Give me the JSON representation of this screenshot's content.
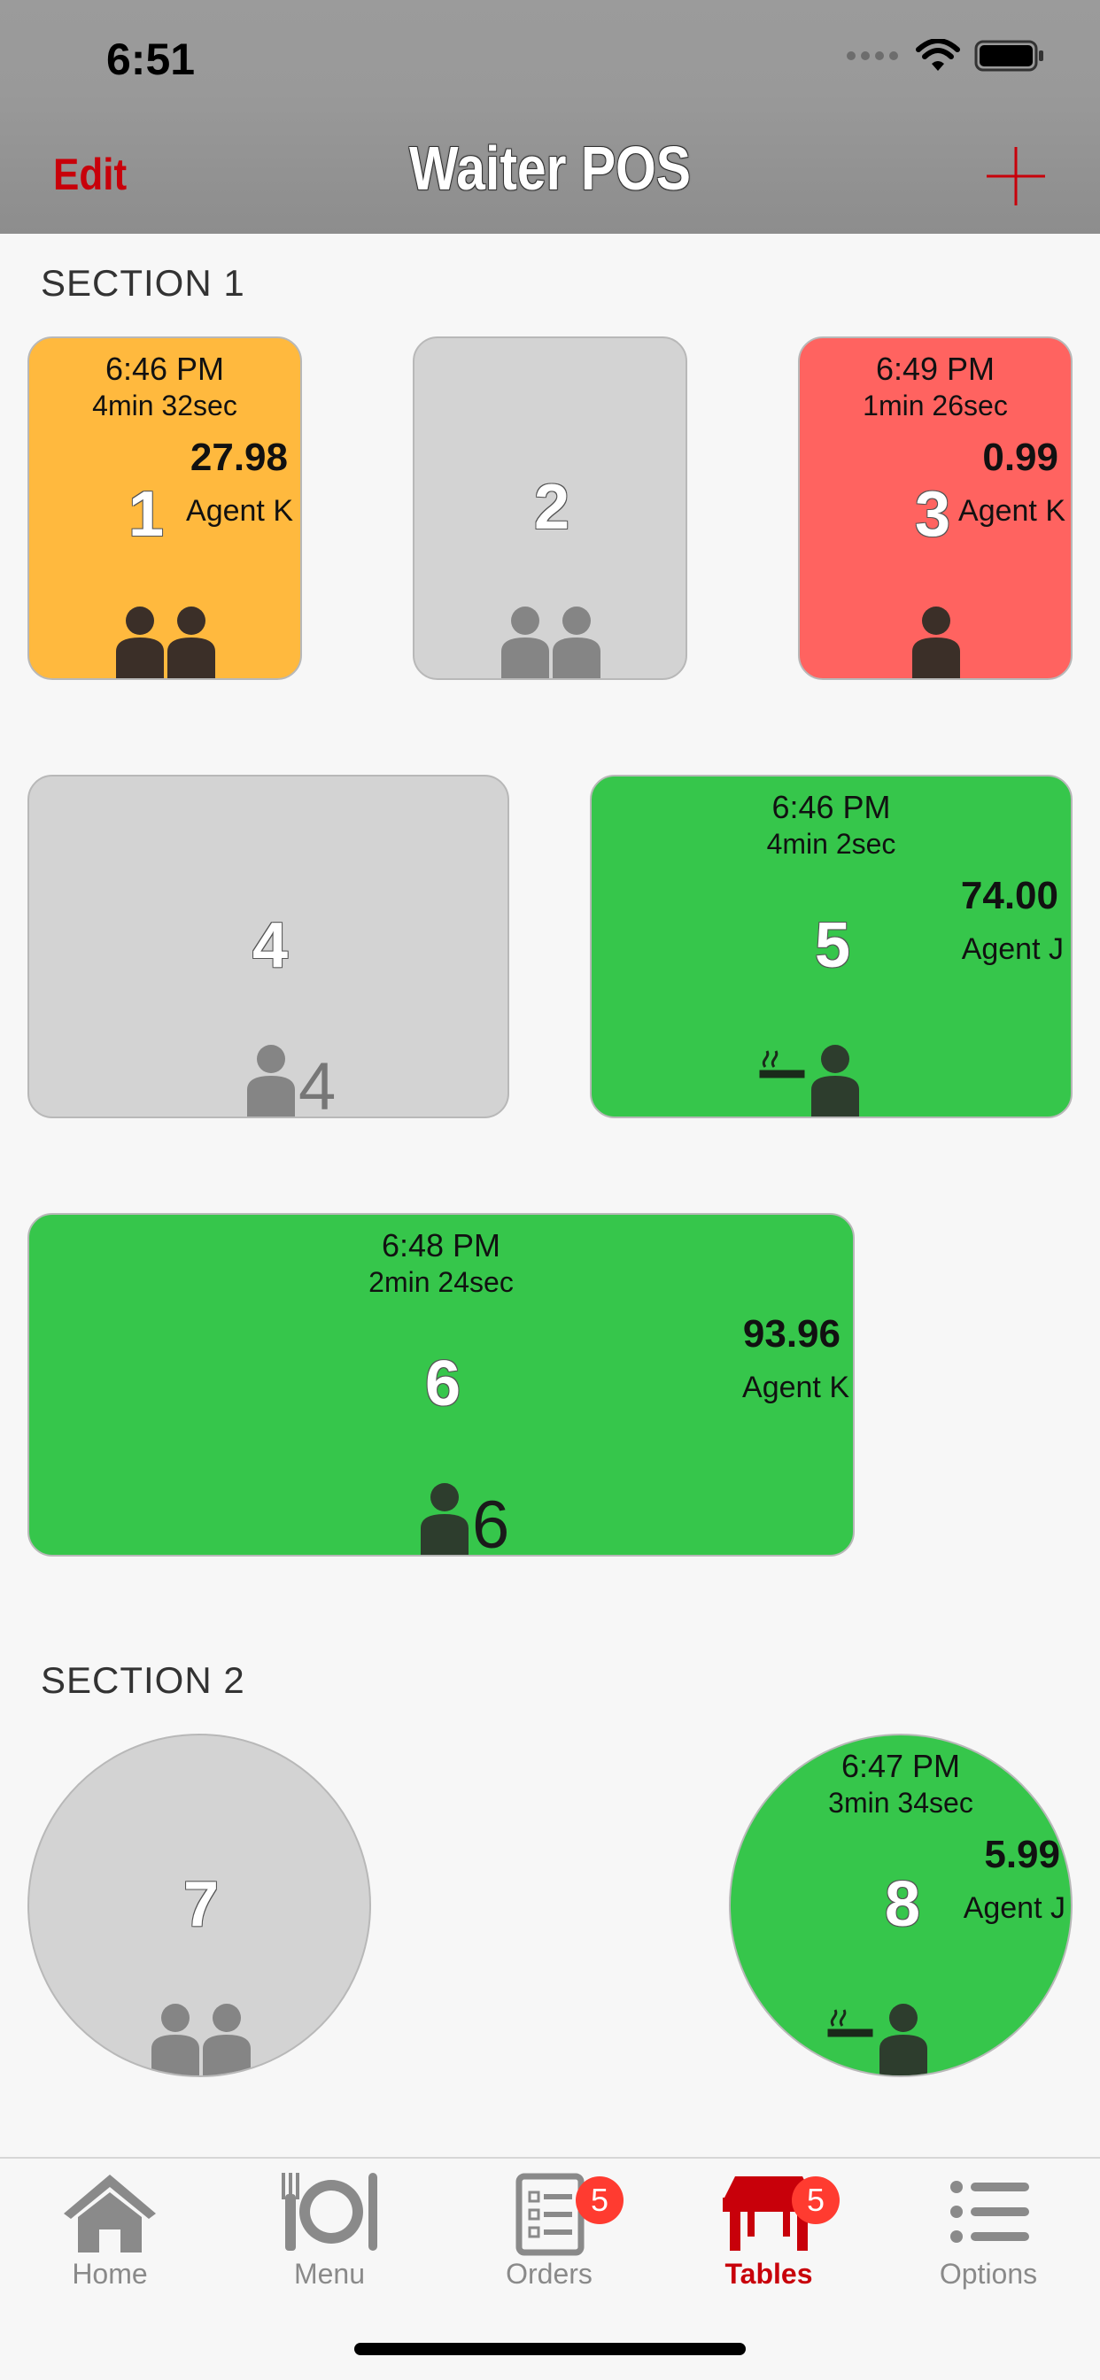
{
  "status_bar": {
    "time": "6:51"
  },
  "nav": {
    "edit_label": "Edit",
    "title": "Waiter POS"
  },
  "sections": [
    {
      "title": "SECTION 1"
    },
    {
      "title": "SECTION 2"
    }
  ],
  "tables": {
    "t1": {
      "number": "1",
      "time": "6:46 PM",
      "elapsed": "4min 32sec",
      "amount": "27.98",
      "agent": "Agent K"
    },
    "t2": {
      "number": "2"
    },
    "t3": {
      "number": "3",
      "time": "6:49 PM",
      "elapsed": "1min 26sec",
      "amount": "0.99",
      "agent": "Agent K"
    },
    "t4": {
      "number": "4",
      "guest_count": "4"
    },
    "t5": {
      "number": "5",
      "time": "6:46 PM",
      "elapsed": "4min 2sec",
      "amount": "74.00",
      "agent": "Agent J"
    },
    "t6": {
      "number": "6",
      "time": "6:48 PM",
      "elapsed": "2min 24sec",
      "amount": "93.96",
      "agent": "Agent K",
      "guest_count": "6"
    },
    "t7": {
      "number": "7"
    },
    "t8": {
      "number": "8",
      "time": "6:47 PM",
      "elapsed": "3min 34sec",
      "amount": "5.99",
      "agent": "Agent J"
    }
  },
  "tabbar": {
    "items": [
      {
        "label": "Home",
        "icon": "home-icon"
      },
      {
        "label": "Menu",
        "icon": "menu-icon"
      },
      {
        "label": "Orders",
        "icon": "orders-icon",
        "badge": "5"
      },
      {
        "label": "Tables",
        "icon": "tables-icon",
        "badge": "5",
        "active": true
      },
      {
        "label": "Options",
        "icon": "options-icon"
      }
    ]
  },
  "colors": {
    "accent": "#c8000a",
    "table_idle": "#d3d3d3",
    "table_orange": "#ffb93e",
    "table_red": "#ff6360",
    "table_green": "#36c64b",
    "badge": "#ff3b30"
  }
}
